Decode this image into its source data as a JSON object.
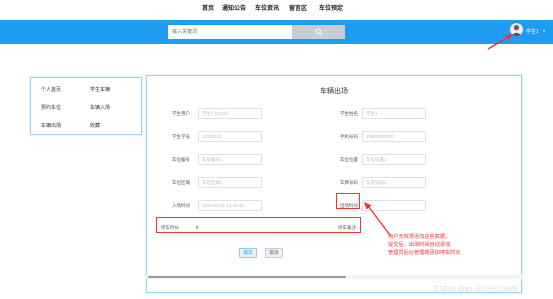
{
  "nav": [
    "首页",
    "通知公告",
    "车位资讯",
    "留言区",
    "车位预定"
  ],
  "search": {
    "placeholder": "输入关键词"
  },
  "user": {
    "name": "学生1",
    "caret": "▾"
  },
  "sidebar": [
    [
      "个人首页",
      "学生车辆"
    ],
    [
      "预约车位",
      "车辆入场"
    ],
    [
      "车辆出场",
      "收藏"
    ]
  ],
  "form": {
    "title": "车辆出场",
    "fields": [
      {
        "label": "学生用户",
        "value": "学生1 (1234)"
      },
      {
        "label": "学生姓名",
        "value": "学生1"
      },
      {
        "label": "学生学号",
        "value": "20210101"
      },
      {
        "label": "手机号码",
        "value": "13800000000"
      },
      {
        "label": "车位编号",
        "value": "车位编号1"
      },
      {
        "label": "车位位置",
        "value": "车位位置1"
      },
      {
        "label": "车位区域",
        "value": "车位区域1"
      },
      {
        "label": "车牌号码",
        "value": "车牌号码1"
      },
      {
        "label": "入场时间",
        "value": "2023-03-01 14:34:45"
      },
      {
        "label": "出场时间",
        "value": ""
      },
      {
        "label": "停车时长",
        "value": "0"
      },
      {
        "label": "停车备注",
        "value": ""
      }
    ],
    "submit": "提交",
    "cancel": "取消"
  },
  "annotation": [
    "用户无权限添加这些数据，",
    "提交后，出场时间自动添加",
    "管理员后台管理端添加停车时长"
  ],
  "watermark": "CSDN @yx_CXKF10088",
  "colors": {
    "bar": "#1f9cf2",
    "annotation": "#ee3333"
  },
  "icons": {
    "search": "search-icon",
    "arrow": "arrow-icon"
  }
}
